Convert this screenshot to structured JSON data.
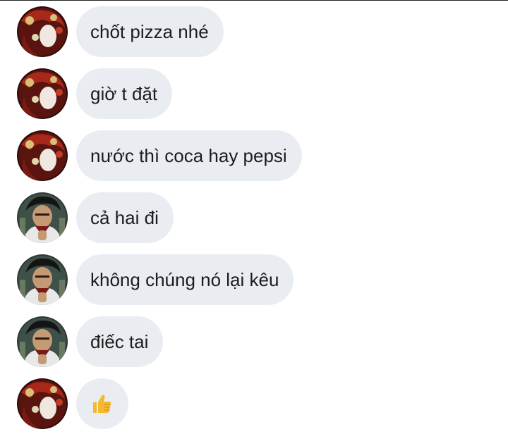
{
  "messages": [
    {
      "text": "chốt pizza nhé",
      "avatar": "red-hair-avatar"
    },
    {
      "text": "giờ t đặt",
      "avatar": "red-hair-avatar"
    },
    {
      "text": "nước thì coca hay pepsi",
      "avatar": "red-hair-avatar"
    },
    {
      "text": "cả hai đi",
      "avatar": "dark-hair-avatar"
    },
    {
      "text": "không chúng nó lại kêu",
      "avatar": "dark-hair-avatar"
    },
    {
      "text": "điếc tai",
      "avatar": "dark-hair-avatar"
    },
    {
      "text": "",
      "avatar": "red-hair-avatar",
      "emoji": "thumbs-up-icon"
    }
  ],
  "colors": {
    "bubble": "#e9edf1",
    "text": "#1c1c1c",
    "thumb": "#f5b82e"
  }
}
